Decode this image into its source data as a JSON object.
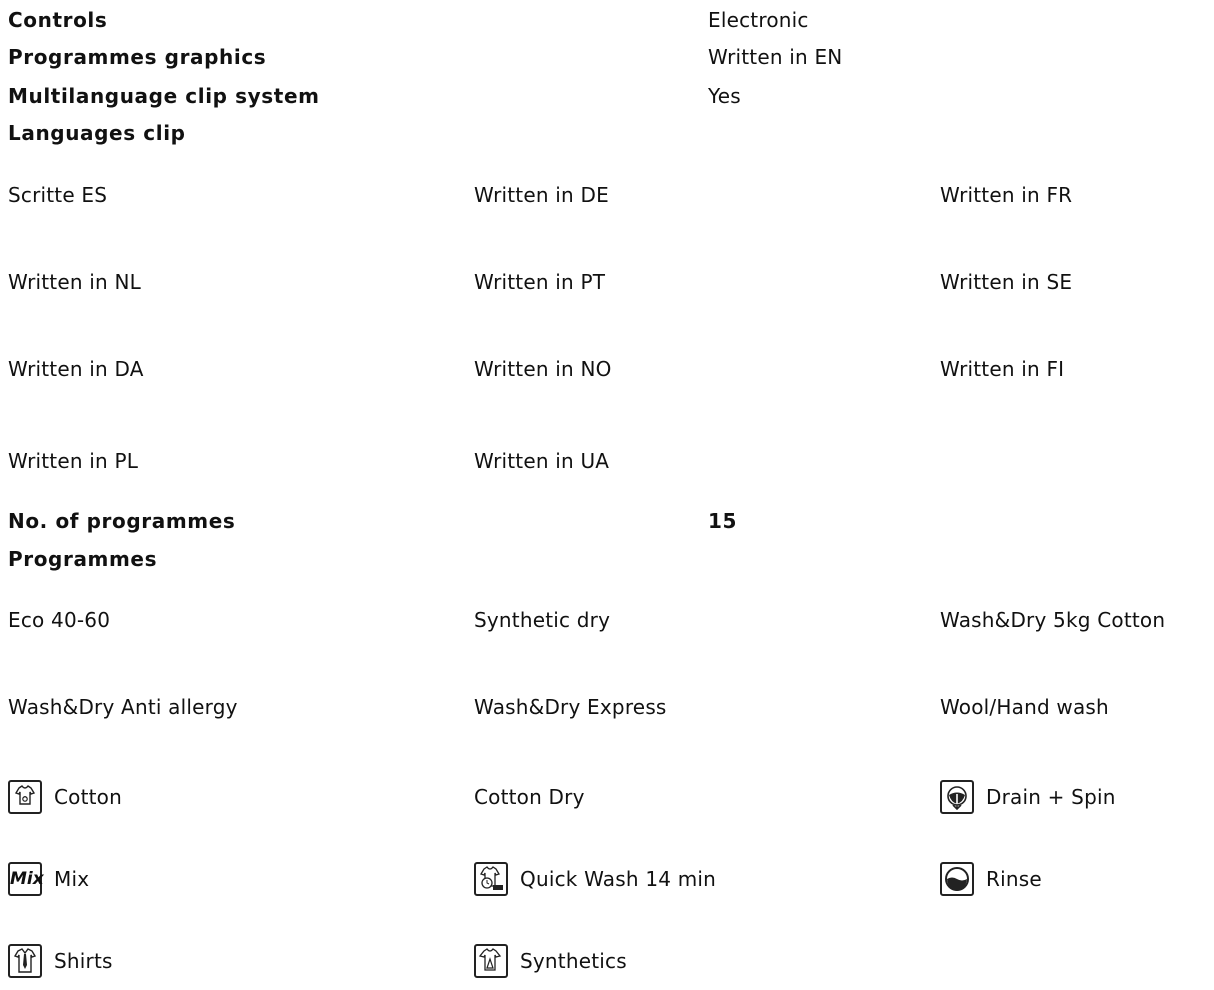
{
  "specs": {
    "controls_label": "Controls",
    "controls_value": "Electronic",
    "graphics_label": "Programmes graphics",
    "graphics_value": "Written in EN",
    "clip_label": "Multilanguage clip system",
    "clip_value": "Yes",
    "languages_label": "Languages clip"
  },
  "languages": [
    "Scritte ES",
    "Written in DE",
    "Written in FR",
    "Written in NL",
    "Written in PT",
    "Written in SE",
    "Written in DA",
    "Written in NO",
    "Written in FI",
    "Written in PL",
    "Written in UA"
  ],
  "programmes_count_label": "No. of programmes",
  "programmes_count_value": "15",
  "programmes_label": "Programmes",
  "programmes": [
    {
      "label": "Eco 40-60",
      "icon": ""
    },
    {
      "label": "Synthetic dry",
      "icon": ""
    },
    {
      "label": "Wash&Dry 5kg Cotton",
      "icon": ""
    },
    {
      "label": "Wash&Dry Anti allergy",
      "icon": ""
    },
    {
      "label": "Wash&Dry Express",
      "icon": ""
    },
    {
      "label": "Wool/Hand wash",
      "icon": ""
    },
    {
      "label": "Cotton",
      "icon": "cotton-icon"
    },
    {
      "label": "Cotton Dry",
      "icon": ""
    },
    {
      "label": "Drain + Spin",
      "icon": "drain-spin-icon"
    },
    {
      "label": "Mix",
      "icon": "mix-icon",
      "icon_text": "Mix"
    },
    {
      "label": "Quick Wash 14 min",
      "icon": "quick-wash-icon"
    },
    {
      "label": "Rinse",
      "icon": "rinse-icon"
    },
    {
      "label": "Shirts",
      "icon": "shirts-icon"
    },
    {
      "label": "Synthetics",
      "icon": "synthetics-icon"
    }
  ]
}
